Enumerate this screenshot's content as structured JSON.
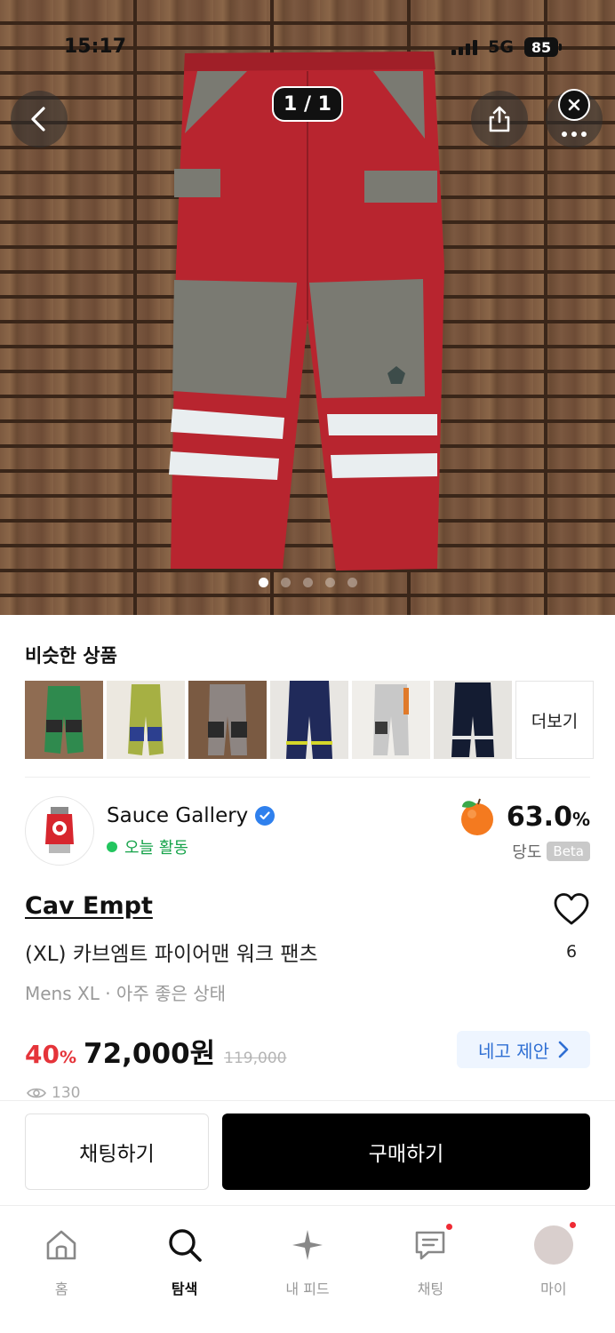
{
  "status_bar": {
    "time": "15:17",
    "network": "5G",
    "battery": "85"
  },
  "gallery": {
    "counter": "1 / 1",
    "page_count": 5,
    "active_page": 1
  },
  "similar": {
    "title": "비슷한 상품",
    "more_label": "더보기",
    "items": [
      {
        "color": "#2f8a4e",
        "accent": "#2a2a2a"
      },
      {
        "color": "#a6b043",
        "accent": "#2c3f8f"
      },
      {
        "color": "#8d8582",
        "accent": "#2a2a2a"
      },
      {
        "color": "#202a5a",
        "accent": "#d4d62a"
      },
      {
        "color": "#c8c8c8",
        "accent": "#3a3a3a"
      },
      {
        "color": "#141c32",
        "accent": "#e8e8e8"
      }
    ]
  },
  "seller": {
    "name": "Sauce Gallery",
    "activity": "오늘 활동",
    "sweetness": "63.0",
    "sweetness_unit": "%",
    "sweetness_label": "당도",
    "beta": "Beta"
  },
  "product": {
    "brand": "Cav Empt",
    "title": "(XL) 카브엠트 파이어맨 워크 팬츠",
    "meta": "Mens XL · 아주 좋은 상태",
    "like_count": "6",
    "discount": "40",
    "discount_unit": "%",
    "price": "72,000원",
    "original_price": "119,000",
    "offer_label": "네고 제안",
    "views": "130"
  },
  "actions": {
    "chat_label": "채팅하기",
    "buy_label": "구매하기"
  },
  "tabs": [
    {
      "label": "홈",
      "icon": "home-icon"
    },
    {
      "label": "탐색",
      "icon": "search-icon"
    },
    {
      "label": "내 피드",
      "icon": "sparkle-icon"
    },
    {
      "label": "채팅",
      "icon": "chat-icon"
    },
    {
      "label": "마이",
      "icon": "profile-icon"
    }
  ],
  "colors": {
    "accent_red": "#e5343a",
    "offer_blue": "#2f6fd3",
    "online_green": "#22c55e",
    "pants_red": "#b8252f",
    "pants_grey": "#7a7a72"
  }
}
